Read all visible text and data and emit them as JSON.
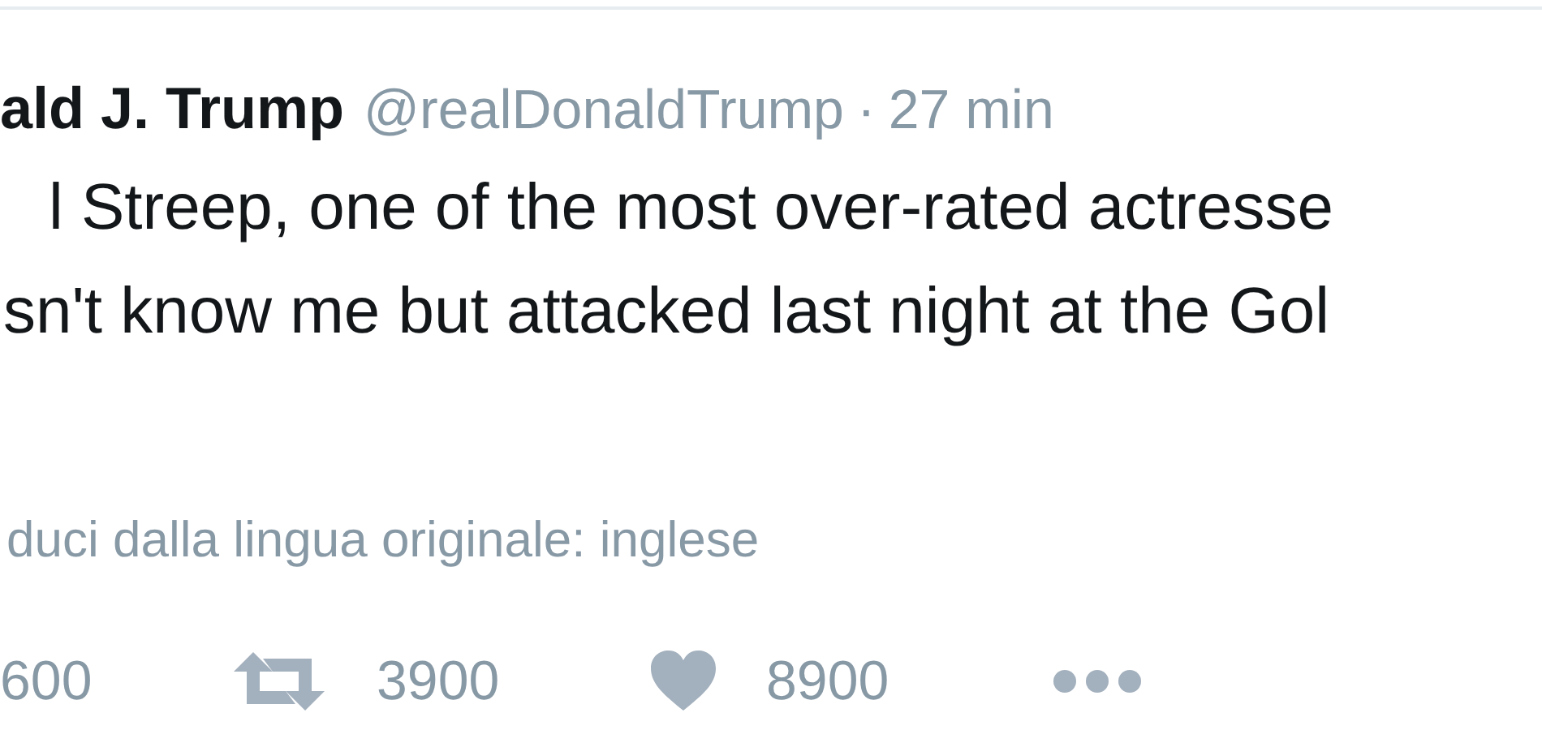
{
  "tweet": {
    "author": "ald J. Trump",
    "handle": "@realDonaldTrump",
    "separator": "·",
    "time": "27 min",
    "text_lines": [
      "l Streep, one of the most over-rated actresse",
      "sn't know me but attacked last night at the Gol"
    ],
    "translate_link": "duci dalla lingua originale: inglese",
    "actions": [
      {
        "kind": "reply",
        "count": "600"
      },
      {
        "kind": "retweet",
        "count": "3900"
      },
      {
        "kind": "like",
        "count": "8900"
      },
      {
        "kind": "more"
      }
    ]
  }
}
